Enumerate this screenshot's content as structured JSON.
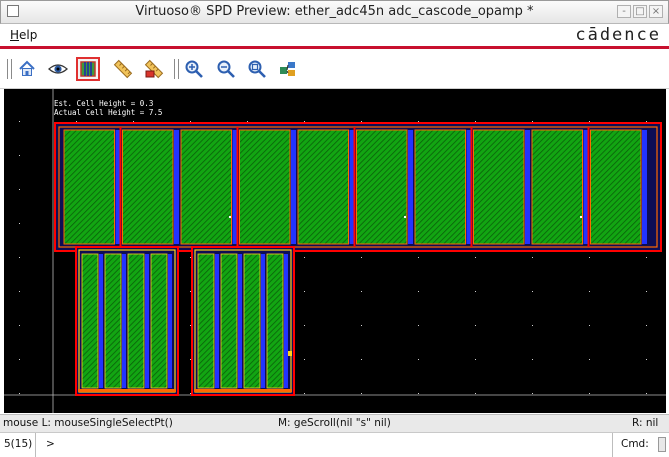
{
  "window": {
    "title": "Virtuoso® SPD Preview: ether_adc45n adc_cascode_opamp *",
    "minimize_glyph": "-",
    "maximize_glyph": "□",
    "close_glyph": "×"
  },
  "menubar": {
    "help_accel": "H",
    "help_rest": "elp",
    "brand": "cādence"
  },
  "toolbar": {
    "buttons": [
      {
        "icon": "home-icon",
        "selected": false
      },
      {
        "icon": "eye-icon",
        "selected": false
      },
      {
        "icon": "cell-view-icon",
        "selected": true
      },
      {
        "icon": "ruler-icon",
        "selected": false
      },
      {
        "icon": "clear-ruler-icon",
        "selected": false
      },
      {
        "icon": "zoom-in-icon",
        "selected": false
      },
      {
        "icon": "zoom-out-icon",
        "selected": false
      },
      {
        "icon": "zoom-fit-icon",
        "selected": false
      },
      {
        "icon": "hierarchy-icon",
        "selected": false
      }
    ]
  },
  "canvas": {
    "background": "#000000",
    "est_cell_height": "Est. Cell Height = 0.3",
    "actual_cell_height": "Actual Cell Height = 7.5",
    "colors": {
      "boundary": "#ff0000",
      "metal": "#ff6a00",
      "diffusion": "#12a512",
      "poly": "#2233ff",
      "highlight": "#ffd21a",
      "grid_dot": "#cfcfcf"
    },
    "upper_row_fingers": 10,
    "lower_left_fingers": 4,
    "lower_right_fingers": 4
  },
  "status": {
    "mouse_left": "mouse L: mouseSingleSelectPt()",
    "mouse_middle": "M: geScroll(nil \"s\"   nil)",
    "mouse_right": "R: nil",
    "command_count": "5(15)",
    "prompt": ">",
    "cmd_label": "Cmd:"
  }
}
